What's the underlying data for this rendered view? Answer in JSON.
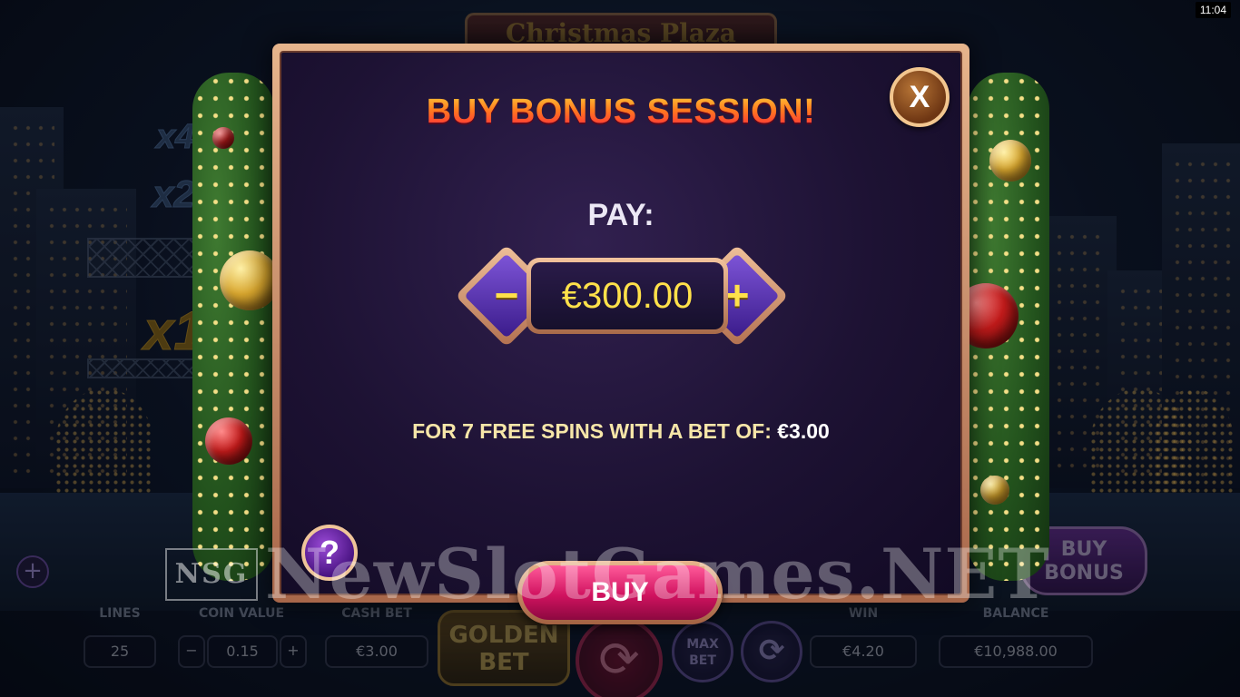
{
  "game": {
    "title": "Christmas Plaza"
  },
  "status": {
    "clock": "11:04"
  },
  "background": {
    "multipliers": [
      "x4",
      "x2",
      "x1"
    ]
  },
  "hud": {
    "lines_label": "LINES",
    "lines_value": "25",
    "coin_value_label": "COIN VALUE",
    "coin_value": "0.15",
    "coin_minus": "−",
    "coin_plus": "+",
    "cash_bet_label": "CASH BET",
    "cash_bet_value": "€3.00",
    "golden_bet": "GOLDEN BET",
    "spin_icon": "⟳",
    "max_bet": "MAX BET",
    "autoplay_icon": "⟳",
    "win_label": "WIN",
    "win_value": "€4.20",
    "balance_label": "BALANCE",
    "balance_value": "€10,988.00",
    "buy_bonus": "BUY BONUS",
    "side_plus": "+"
  },
  "modal": {
    "title": "BUY BONUS SESSION!",
    "close_label": "X",
    "pay_label": "PAY:",
    "amount": "€300.00",
    "minus_label": "−",
    "plus_label": "+",
    "spins_text": "FOR 7 FREE SPINS WITH A BET OF:",
    "bet_value": "€3.00",
    "help_label": "?",
    "buy_label": "BUY"
  },
  "watermark": {
    "logo": "NSG",
    "text": "NewSlotGames.NET"
  },
  "colors": {
    "title_gradient": [
      "#ffd13a",
      "#ff1f3f"
    ],
    "amount_text": "#ffe14a",
    "buy_button": "#d0125f",
    "modal_frame": "#c98a66"
  }
}
